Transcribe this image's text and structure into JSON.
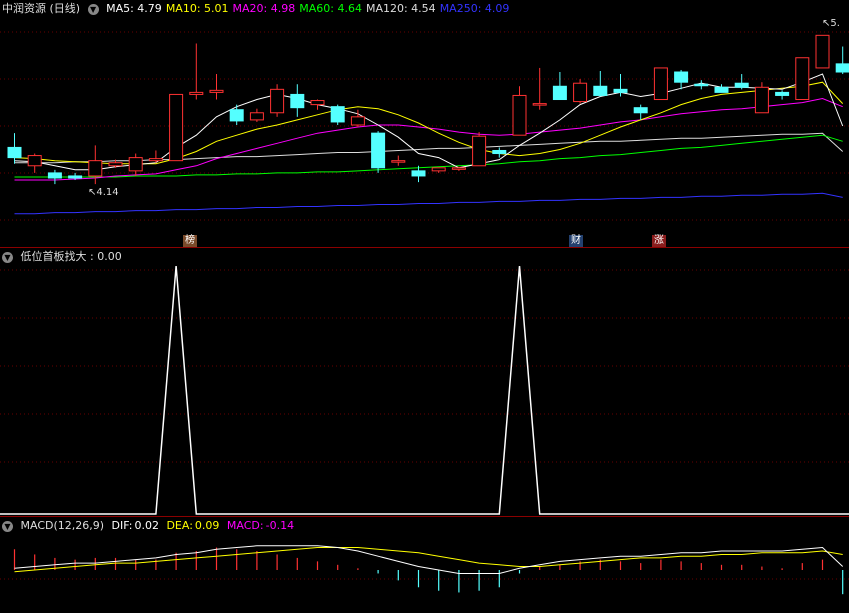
{
  "main": {
    "title": "中润资源 (日线)",
    "ma": [
      {
        "label": "MA5:",
        "value": "4.79",
        "color": "#ffffff"
      },
      {
        "label": "MA10:",
        "value": "5.01",
        "color": "#ffff00"
      },
      {
        "label": "MA20:",
        "value": "4.98",
        "color": "#ff00ff"
      },
      {
        "label": "MA60:",
        "value": "4.64",
        "color": "#00ff00"
      },
      {
        "label": "MA120:",
        "value": "4.54",
        "color": "#dddddd"
      },
      {
        "label": "MA250:",
        "value": "4.09",
        "color": "#3333ff"
      }
    ],
    "low_marker": "4.14",
    "high_marker": "5.",
    "badges": [
      {
        "text": "榜",
        "bg": "#7a4a2a"
      },
      {
        "text": "财",
        "bg": "#23406e"
      },
      {
        "text": "涨",
        "bg": "#8a1c1c"
      }
    ]
  },
  "indicator": {
    "title": "低位首板找大",
    "value": ": 0.00"
  },
  "macd": {
    "title": "MACD(12,26,9)",
    "dif_label": "DIF:",
    "dif_value": "0.02",
    "dea_label": "DEA:",
    "dea_value": "0.09",
    "macd_label": "MACD:",
    "macd_value": "-0.14"
  },
  "colors": {
    "up": "#ff3232",
    "down": "#54ffff",
    "grid": "#8b0000",
    "bg": "#000000"
  },
  "chart_data": [
    {
      "type": "candlestick",
      "ylim": [
        3.75,
        5.85
      ],
      "candles": [
        [
          4.58,
          4.48,
          4.72,
          4.42
        ],
        [
          4.4,
          4.5,
          4.52,
          4.33
        ],
        [
          4.33,
          4.28,
          4.36,
          4.22
        ],
        [
          4.3,
          4.28,
          4.33,
          4.26
        ],
        [
          4.3,
          4.45,
          4.6,
          4.22
        ],
        [
          4.4,
          4.43,
          4.46,
          4.38
        ],
        [
          4.35,
          4.48,
          4.52,
          4.3
        ],
        [
          4.45,
          4.47,
          4.55,
          4.43
        ],
        [
          4.45,
          5.1,
          5.1,
          4.45
        ],
        [
          5.1,
          5.12,
          5.6,
          5.05
        ],
        [
          5.12,
          5.14,
          5.3,
          5.05
        ],
        [
          4.95,
          4.84,
          5.0,
          4.8
        ],
        [
          4.85,
          4.92,
          4.96,
          4.83
        ],
        [
          4.92,
          5.15,
          5.2,
          4.88
        ],
        [
          5.1,
          4.97,
          5.2,
          4.88
        ],
        [
          5.0,
          5.04,
          5.05,
          4.95
        ],
        [
          4.98,
          4.83,
          5.0,
          4.8
        ],
        [
          4.8,
          4.88,
          4.95,
          4.78
        ],
        [
          4.72,
          4.38,
          4.74,
          4.33
        ],
        [
          4.44,
          4.45,
          4.5,
          4.4
        ],
        [
          4.35,
          4.3,
          4.4,
          4.24
        ],
        [
          4.35,
          4.38,
          4.38,
          4.33
        ],
        [
          4.37,
          4.38,
          4.39,
          4.35
        ],
        [
          4.4,
          4.69,
          4.73,
          4.4
        ],
        [
          4.55,
          4.52,
          4.58,
          4.48
        ],
        [
          4.7,
          5.09,
          5.18,
          4.7
        ],
        [
          5.0,
          5.01,
          5.36,
          4.95
        ],
        [
          5.18,
          5.05,
          5.32,
          5.05
        ],
        [
          5.03,
          5.21,
          5.25,
          5.01
        ],
        [
          5.18,
          5.09,
          5.33,
          5.08
        ],
        [
          5.15,
          5.12,
          5.3,
          5.08
        ],
        [
          4.97,
          4.92,
          5.0,
          4.85
        ],
        [
          5.05,
          5.36,
          5.36,
          5.05
        ],
        [
          5.32,
          5.22,
          5.34,
          5.15
        ],
        [
          5.2,
          5.19,
          5.24,
          5.15
        ],
        [
          5.17,
          5.12,
          5.2,
          5.12
        ],
        [
          5.21,
          5.17,
          5.3,
          5.15
        ],
        [
          4.92,
          5.17,
          5.22,
          4.92
        ],
        [
          5.12,
          5.09,
          5.14,
          5.05
        ],
        [
          5.05,
          5.46,
          5.46,
          5.05
        ],
        [
          5.36,
          5.68,
          5.68,
          5.36
        ],
        [
          5.4,
          5.32,
          5.57,
          5.3
        ]
      ],
      "ma5": [
        4.45,
        4.44,
        4.4,
        4.36,
        4.36,
        4.39,
        4.41,
        4.43,
        4.58,
        4.7,
        4.88,
        4.98,
        5.05,
        5.1,
        5.06,
        5.0,
        4.96,
        4.91,
        4.8,
        4.68,
        4.52,
        4.48,
        4.38,
        4.42,
        4.46,
        4.6,
        4.72,
        4.85,
        5.0,
        5.08,
        5.12,
        5.08,
        5.11,
        5.16,
        5.21,
        5.17,
        5.17,
        5.16,
        5.15,
        5.22,
        5.3,
        4.79
      ],
      "ma10": [
        4.48,
        4.47,
        4.45,
        4.44,
        4.43,
        4.42,
        4.42,
        4.42,
        4.47,
        4.54,
        4.64,
        4.7,
        4.76,
        4.8,
        4.85,
        4.9,
        4.95,
        4.98,
        4.96,
        4.9,
        4.82,
        4.72,
        4.63,
        4.56,
        4.52,
        4.5,
        4.52,
        4.56,
        4.62,
        4.7,
        4.78,
        4.85,
        4.92,
        5.0,
        5.06,
        5.1,
        5.12,
        5.14,
        5.16,
        5.18,
        5.22,
        5.01
      ],
      "ma20": [
        4.26,
        4.26,
        4.26,
        4.27,
        4.28,
        4.3,
        4.31,
        4.32,
        4.36,
        4.4,
        4.47,
        4.52,
        4.57,
        4.62,
        4.67,
        4.72,
        4.75,
        4.78,
        4.8,
        4.8,
        4.78,
        4.76,
        4.73,
        4.71,
        4.7,
        4.71,
        4.73,
        4.75,
        4.77,
        4.8,
        4.83,
        4.85,
        4.88,
        4.91,
        4.93,
        4.95,
        4.96,
        4.98,
        5.0,
        5.02,
        5.06,
        4.98
      ],
      "ma60": [
        4.29,
        4.29,
        4.29,
        4.29,
        4.29,
        4.29,
        4.3,
        4.3,
        4.3,
        4.31,
        4.31,
        4.32,
        4.32,
        4.33,
        4.33,
        4.34,
        4.34,
        4.35,
        4.36,
        4.37,
        4.38,
        4.39,
        4.4,
        4.41,
        4.42,
        4.44,
        4.45,
        4.47,
        4.48,
        4.5,
        4.51,
        4.53,
        4.55,
        4.57,
        4.58,
        4.6,
        4.62,
        4.64,
        4.66,
        4.68,
        4.7,
        4.64
      ],
      "ma120": [
        4.43,
        4.43,
        4.43,
        4.44,
        4.44,
        4.45,
        4.45,
        4.46,
        4.46,
        4.47,
        4.48,
        4.49,
        4.49,
        4.5,
        4.51,
        4.52,
        4.53,
        4.53,
        4.54,
        4.55,
        4.56,
        4.57,
        4.57,
        4.58,
        4.59,
        4.6,
        4.61,
        4.62,
        4.63,
        4.64,
        4.64,
        4.65,
        4.66,
        4.67,
        4.67,
        4.68,
        4.69,
        4.7,
        4.71,
        4.71,
        4.72,
        4.54
      ],
      "ma250": [
        3.93,
        3.93,
        3.94,
        3.94,
        3.95,
        3.95,
        3.96,
        3.96,
        3.97,
        3.97,
        3.98,
        3.98,
        3.99,
        3.99,
        4.0,
        4.0,
        4.01,
        4.01,
        4.02,
        4.02,
        4.03,
        4.03,
        4.04,
        4.04,
        4.05,
        4.05,
        4.06,
        4.06,
        4.07,
        4.07,
        4.08,
        4.08,
        4.09,
        4.09,
        4.1,
        4.1,
        4.11,
        4.11,
        4.12,
        4.12,
        4.13,
        4.09
      ]
    },
    {
      "type": "line",
      "ylim": [
        0,
        1
      ],
      "values": [
        0,
        0,
        0,
        0,
        0,
        0,
        0,
        0,
        1,
        0,
        0,
        0,
        0,
        0,
        0,
        0,
        0,
        0,
        0,
        0,
        0,
        0,
        0,
        0,
        0,
        1,
        0,
        0,
        0,
        0,
        0,
        0,
        0,
        0,
        0,
        0,
        0,
        0,
        0,
        0,
        0,
        0
      ]
    },
    {
      "type": "bar",
      "ylim": [
        -0.22,
        0.22
      ],
      "macd": [
        0.12,
        0.09,
        0.07,
        0.06,
        0.07,
        0.07,
        0.06,
        0.06,
        0.1,
        0.11,
        0.13,
        0.12,
        0.11,
        0.09,
        0.07,
        0.05,
        0.03,
        0.01,
        -0.02,
        -0.06,
        -0.1,
        -0.12,
        -0.13,
        -0.12,
        -0.1,
        -0.02,
        0.02,
        0.03,
        0.05,
        0.06,
        0.05,
        0.04,
        0.06,
        0.05,
        0.04,
        0.03,
        0.03,
        0.02,
        0.01,
        0.04,
        0.06,
        -0.14
      ],
      "dif": [
        0.01,
        0.02,
        0.03,
        0.04,
        0.04,
        0.05,
        0.06,
        0.07,
        0.09,
        0.1,
        0.12,
        0.13,
        0.14,
        0.14,
        0.14,
        0.14,
        0.13,
        0.11,
        0.08,
        0.05,
        0.02,
        0.0,
        -0.02,
        -0.02,
        -0.02,
        0.01,
        0.03,
        0.05,
        0.06,
        0.07,
        0.08,
        0.08,
        0.09,
        0.1,
        0.1,
        0.11,
        0.11,
        0.11,
        0.11,
        0.12,
        0.13,
        0.02
      ],
      "dea": [
        -0.01,
        0.0,
        0.01,
        0.02,
        0.03,
        0.04,
        0.04,
        0.05,
        0.06,
        0.07,
        0.08,
        0.09,
        0.1,
        0.11,
        0.12,
        0.13,
        0.13,
        0.13,
        0.12,
        0.11,
        0.1,
        0.08,
        0.06,
        0.04,
        0.03,
        0.02,
        0.02,
        0.03,
        0.04,
        0.05,
        0.06,
        0.07,
        0.07,
        0.08,
        0.08,
        0.09,
        0.09,
        0.1,
        0.1,
        0.1,
        0.11,
        0.09
      ]
    }
  ]
}
